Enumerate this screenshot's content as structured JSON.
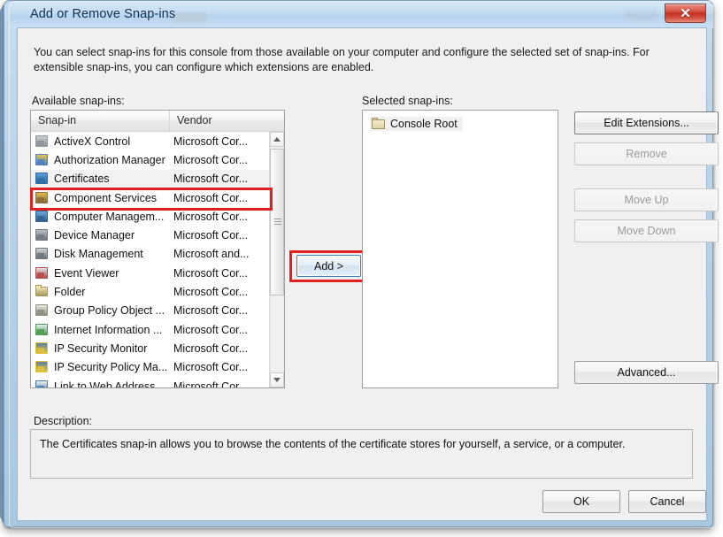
{
  "window": {
    "title": "Add or Remove Snap-ins",
    "close_label": "✕"
  },
  "intro_text": "You can select snap-ins for this console from those available on your computer and configure the selected set of snap-ins. For extensible snap-ins, you can configure which extensions are enabled.",
  "labels": {
    "available": "Available snap-ins:",
    "selected": "Selected snap-ins:",
    "description": "Description:"
  },
  "available_list": {
    "columns": [
      "Snap-in",
      "Vendor"
    ],
    "rows": [
      {
        "name": "ActiveX Control",
        "vendor": "Microsoft Cor...",
        "icon": "activex-icon",
        "selected": false
      },
      {
        "name": "Authorization Manager",
        "vendor": "Microsoft Cor...",
        "icon": "authorization-manager-icon",
        "selected": false
      },
      {
        "name": "Certificates",
        "vendor": "Microsoft Cor...",
        "icon": "certificates-icon",
        "selected": true
      },
      {
        "name": "Component Services",
        "vendor": "Microsoft Cor...",
        "icon": "component-services-icon",
        "selected": false
      },
      {
        "name": "Computer Managem...",
        "vendor": "Microsoft Cor...",
        "icon": "computer-management-icon",
        "selected": false
      },
      {
        "name": "Device Manager",
        "vendor": "Microsoft Cor...",
        "icon": "device-manager-icon",
        "selected": false
      },
      {
        "name": "Disk Management",
        "vendor": "Microsoft and...",
        "icon": "disk-management-icon",
        "selected": false
      },
      {
        "name": "Event Viewer",
        "vendor": "Microsoft Cor...",
        "icon": "event-viewer-icon",
        "selected": false
      },
      {
        "name": "Folder",
        "vendor": "Microsoft Cor...",
        "icon": "folder-icon",
        "selected": false
      },
      {
        "name": "Group Policy Object ...",
        "vendor": "Microsoft Cor...",
        "icon": "group-policy-icon",
        "selected": false
      },
      {
        "name": "Internet Information ...",
        "vendor": "Microsoft Cor...",
        "icon": "internet-information-icon",
        "selected": false
      },
      {
        "name": "IP Security Monitor",
        "vendor": "Microsoft Cor...",
        "icon": "ip-security-monitor-icon",
        "selected": false
      },
      {
        "name": "IP Security Policy Ma...",
        "vendor": "Microsoft Cor...",
        "icon": "ip-security-policy-icon",
        "selected": false
      },
      {
        "name": "Link to Web Address",
        "vendor": "Microsoft Cor...",
        "icon": "link-web-address-icon",
        "selected": false
      }
    ]
  },
  "add_button": {
    "label": "Add >"
  },
  "selected_list": {
    "items": [
      {
        "label": "Console Root",
        "icon": "folder-icon"
      }
    ]
  },
  "side_buttons": [
    {
      "label": "Edit Extensions...",
      "enabled": true
    },
    {
      "label": "Remove",
      "enabled": false
    },
    {
      "label": "Move Up",
      "enabled": false
    },
    {
      "label": "Move Down",
      "enabled": false
    }
  ],
  "advanced_button": {
    "label": "Advanced..."
  },
  "description": "The Certificates snap-in allows you to browse the contents of the certificate stores for yourself, a service, or a computer.",
  "footer": {
    "ok": "OK",
    "cancel": "Cancel"
  },
  "colors": {
    "annotation": "#e02020",
    "close_button": "#c3301f",
    "title_text": "#11304e",
    "focus_border": "#3c7fb1"
  }
}
